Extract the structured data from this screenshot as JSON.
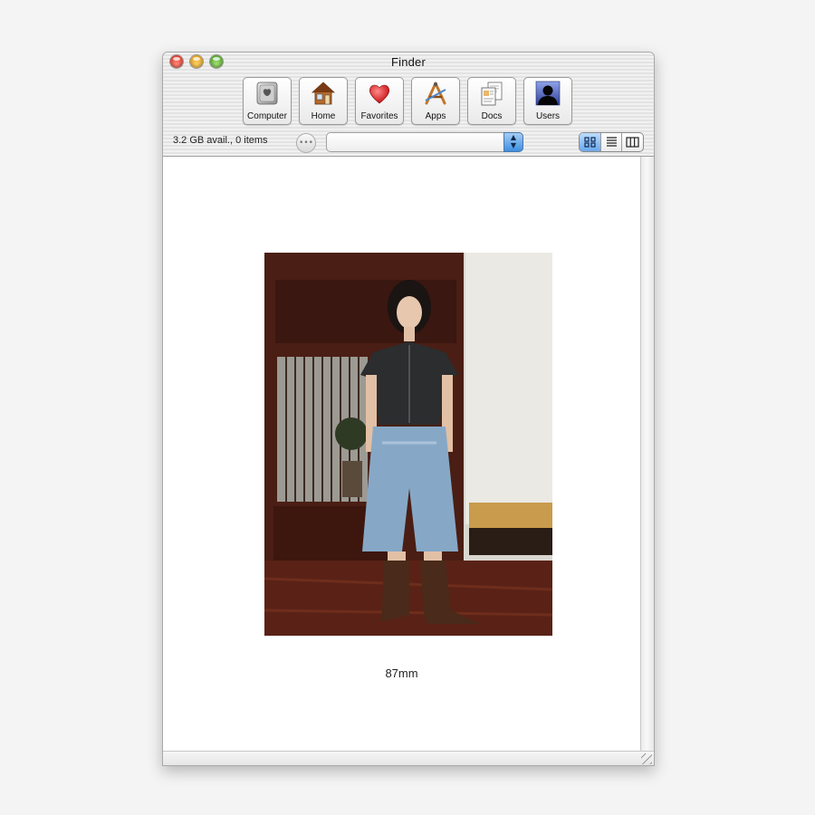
{
  "window": {
    "title": "Finder"
  },
  "toolbar": {
    "items": [
      {
        "label": "Computer",
        "icon": "computer-icon"
      },
      {
        "label": "Home",
        "icon": "home-icon"
      },
      {
        "label": "Favorites",
        "icon": "heart-icon"
      },
      {
        "label": "Apps",
        "icon": "apps-icon"
      },
      {
        "label": "Docs",
        "icon": "documents-icon"
      },
      {
        "label": "Users",
        "icon": "user-silhouette-icon"
      }
    ]
  },
  "statusbar": {
    "text": "3.2 GB avail., 0 items",
    "path_value": "",
    "view_modes": [
      "icon-view",
      "list-view",
      "column-view"
    ],
    "selected_view": "icon-view"
  },
  "content": {
    "caption": "87mm"
  },
  "colors": {
    "accent": "#5a9ce8",
    "close": "#e0443a",
    "minimize": "#f0b43a",
    "zoom": "#5fb43a"
  }
}
